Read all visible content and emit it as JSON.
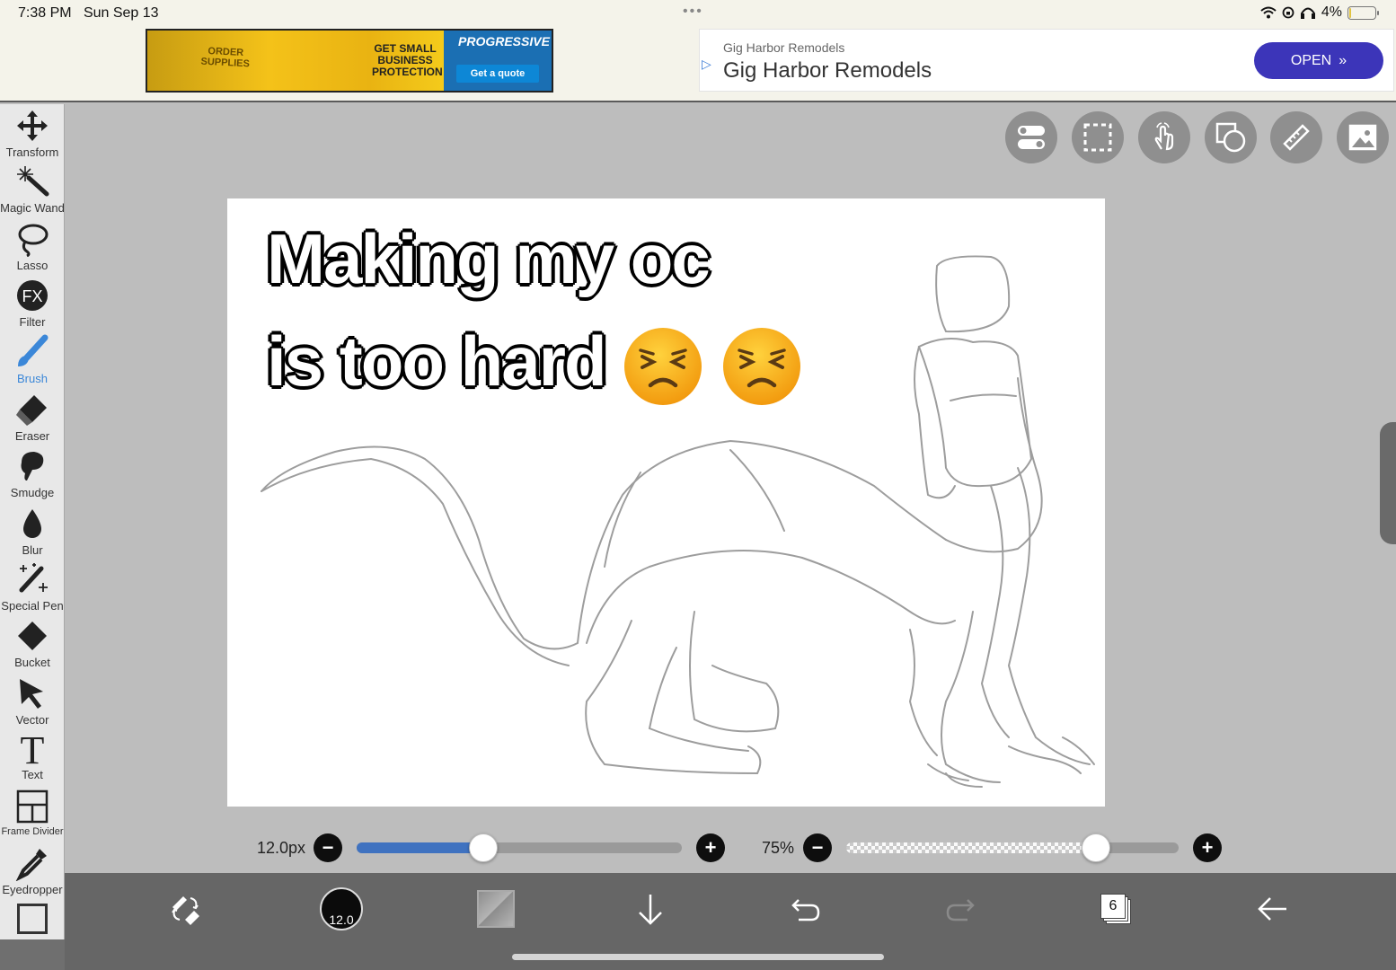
{
  "status_bar": {
    "time": "7:38 PM",
    "date": "Sun Sep 13",
    "battery": "4%",
    "battery_level": 0.04
  },
  "banner_ad": {
    "left_text": "ORDER SUPPLIES",
    "mid_text": "GET SMALL BUSINESS PROTECTION",
    "brand": "PROGRESSIVE",
    "cta": "Get a quote"
  },
  "search_ad": {
    "advertiser": "Gig Harbor Remodels",
    "title": "Gig Harbor Remodels",
    "open_label": "OPEN"
  },
  "left_toolbar": {
    "tools": [
      {
        "label": "Transform",
        "icon": "move-arrows-icon"
      },
      {
        "label": "Magic Wand",
        "icon": "magic-wand-icon"
      },
      {
        "label": "Lasso",
        "icon": "lasso-icon"
      },
      {
        "label": "Filter",
        "icon": "fx-icon",
        "glyph": "FX"
      },
      {
        "label": "Brush",
        "icon": "brush-icon",
        "active": true
      },
      {
        "label": "Eraser",
        "icon": "eraser-icon"
      },
      {
        "label": "Smudge",
        "icon": "smudge-icon"
      },
      {
        "label": "Blur",
        "icon": "droplet-icon"
      },
      {
        "label": "Special Pen",
        "icon": "special-pen-icon"
      },
      {
        "label": "Bucket",
        "icon": "bucket-icon"
      },
      {
        "label": "Vector",
        "icon": "cursor-arrow-icon"
      },
      {
        "label": "Text",
        "icon": "text-icon",
        "glyph": "T"
      },
      {
        "label": "Frame Divider",
        "icon": "frame-divider-icon"
      },
      {
        "label": "Eyedropper",
        "icon": "eyedropper-icon"
      }
    ],
    "active_color": "#3b87d8"
  },
  "top_right_tools": [
    {
      "name": "toggle-settings-icon"
    },
    {
      "name": "selection-icon"
    },
    {
      "name": "hand-touch-icon"
    },
    {
      "name": "shapes-icon"
    },
    {
      "name": "ruler-icon"
    },
    {
      "name": "image-icon"
    }
  ],
  "canvas": {
    "line1": "Making my oc",
    "line2": "is too hard",
    "emoji": [
      "persevering-face",
      "persevering-face"
    ]
  },
  "brush_size_slider": {
    "value_label": "12.0px",
    "fraction": 0.39,
    "fill_color": "#3f72c0"
  },
  "opacity_slider": {
    "value_label": "75%",
    "fraction": 0.75
  },
  "bottom_toolbar": {
    "brush_size_badge": "12.0",
    "layers_count": "6",
    "buttons": [
      "swap-tools-icon",
      "brush-size-icon",
      "color-swatch",
      "download-arrow-icon",
      "undo-icon",
      "redo-icon",
      "layers-icon",
      "back-arrow-icon"
    ]
  }
}
